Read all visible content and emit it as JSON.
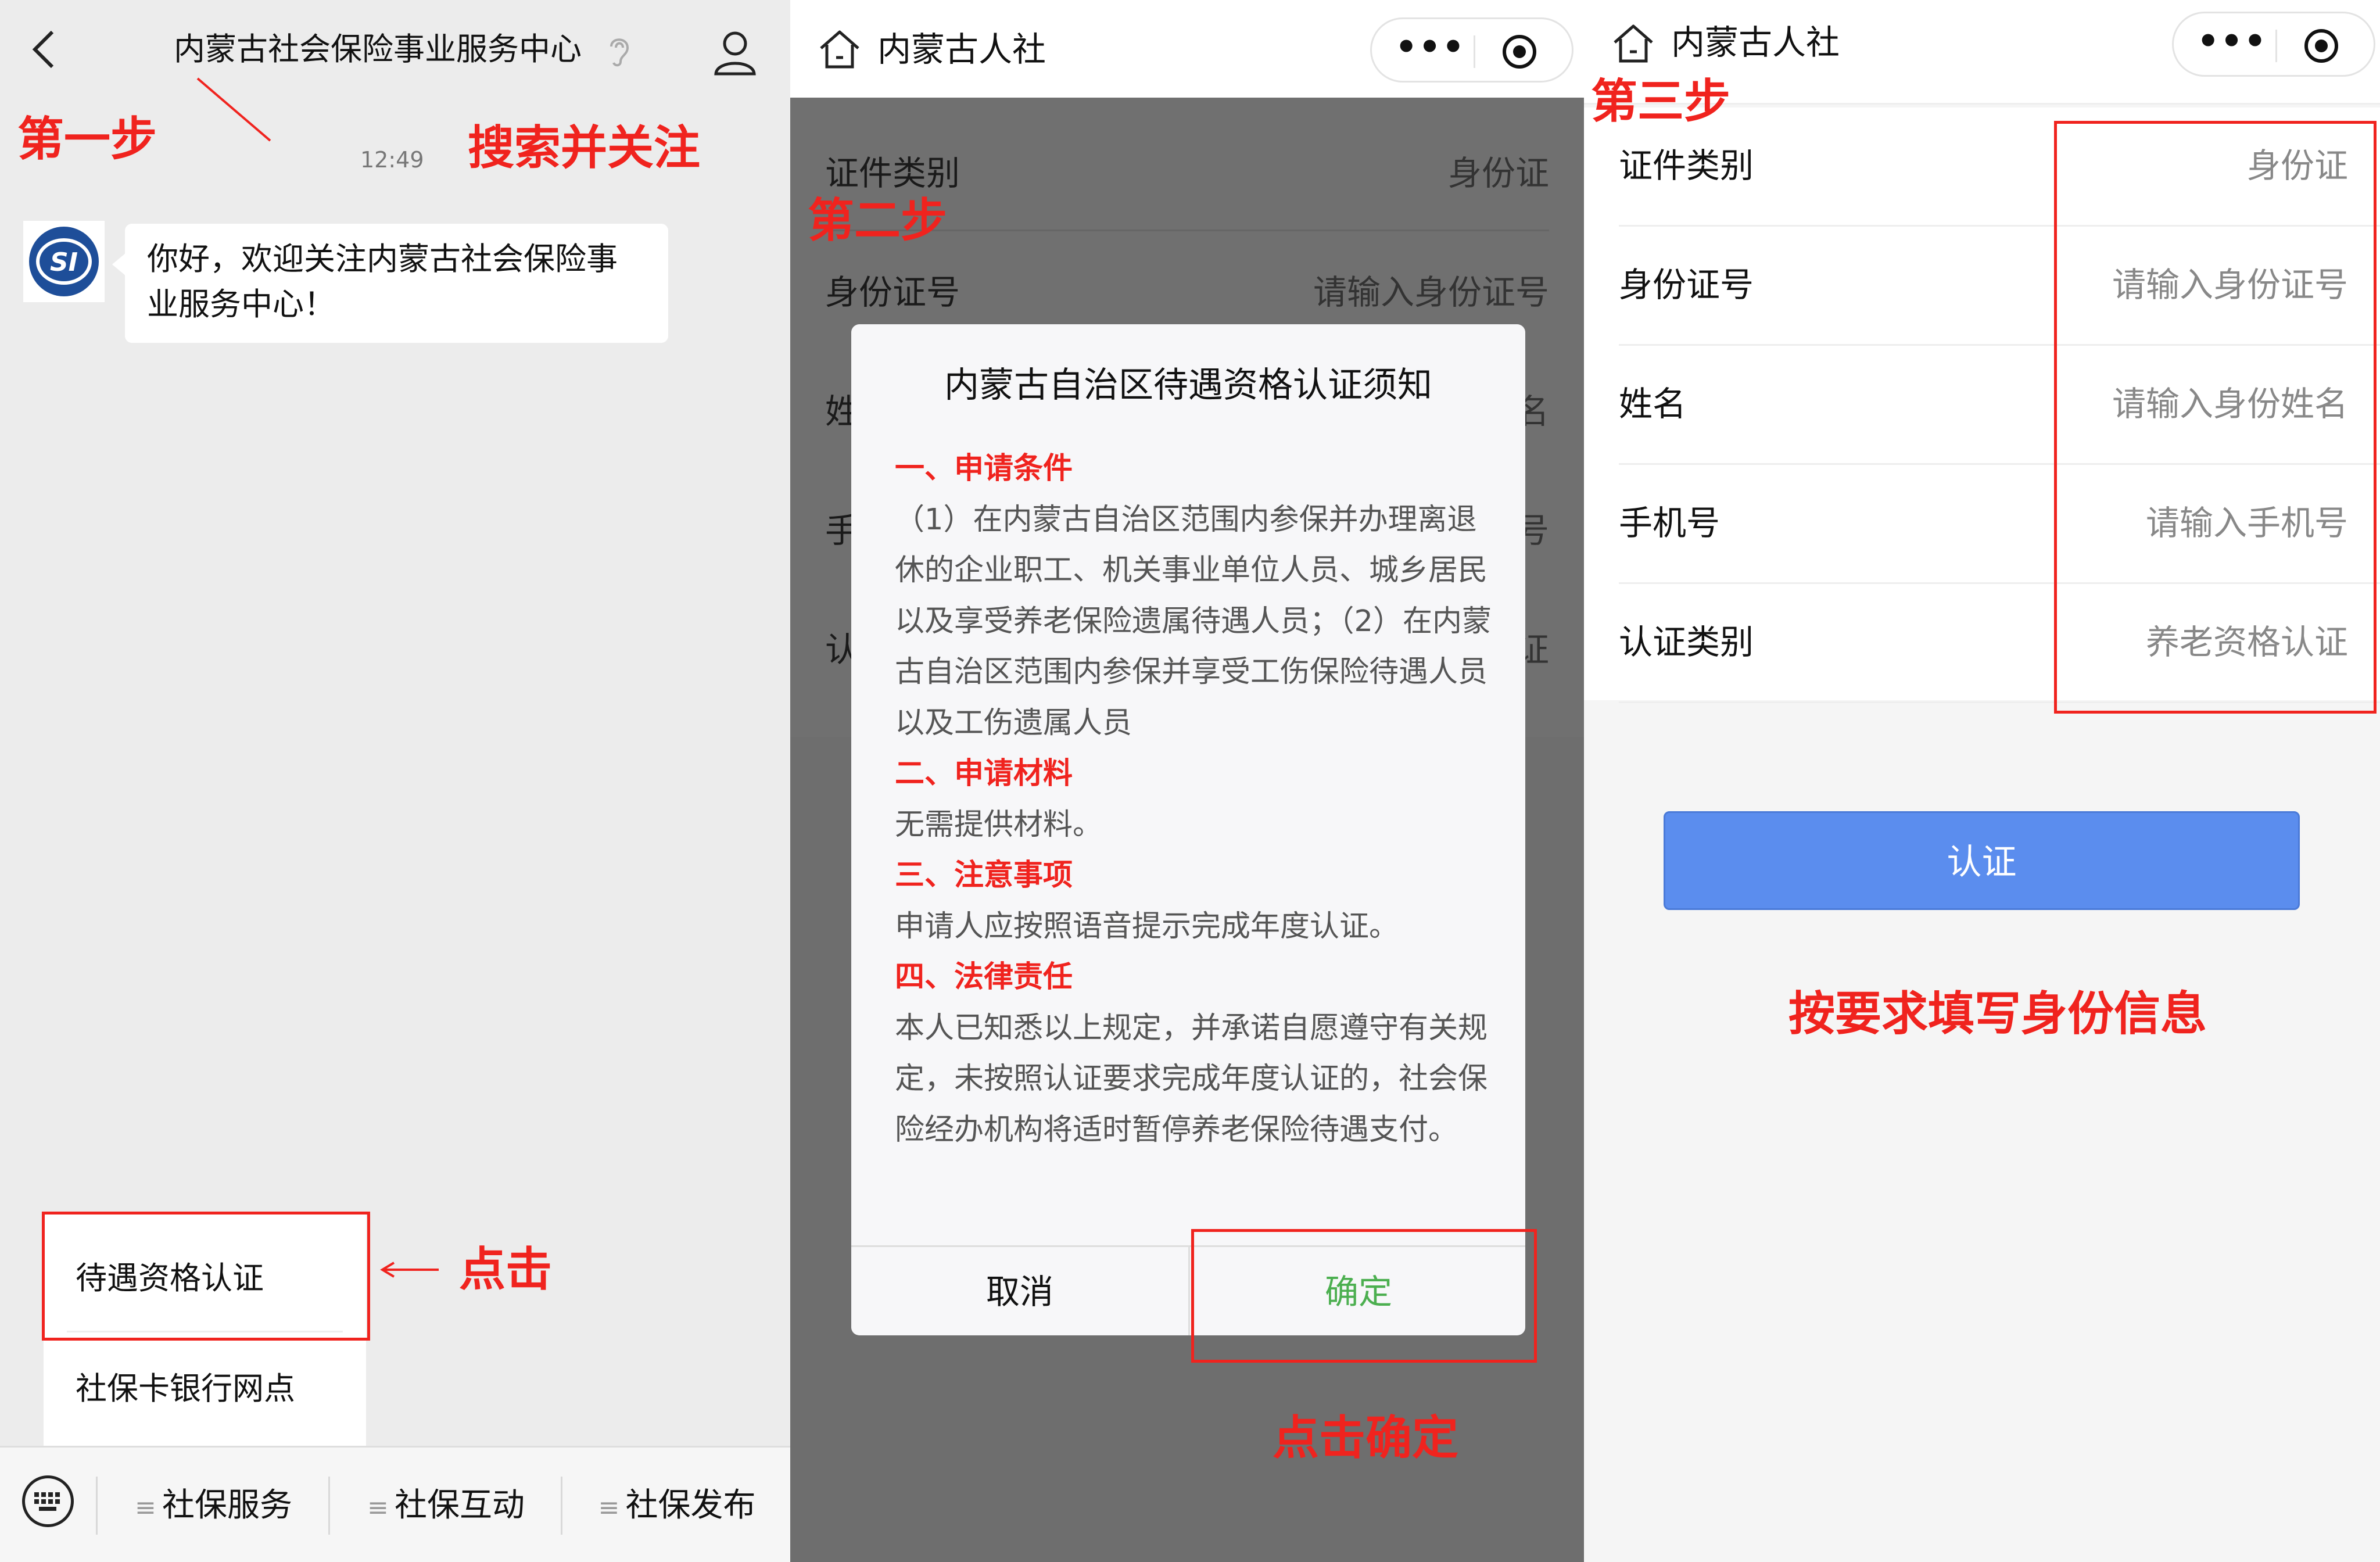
{
  "panel1": {
    "title": "内蒙古社会保险事业服务中心",
    "step_label": "第一步",
    "follow_hint": "搜索并关注",
    "time": "12:49",
    "avatar_text": "SI",
    "welcome_message": "你好，欢迎关注内蒙古社会保险事业服务中心！",
    "menu_items": [
      "待遇资格认证",
      "社保卡银行网点"
    ],
    "click_hint": "点击",
    "tabs": [
      "社保服务",
      "社保互动",
      "社保发布"
    ],
    "tab_icon": "≡"
  },
  "panel2": {
    "header_title": "内蒙古人社",
    "capsule_dots": "•••",
    "step_label": "第二步",
    "bg_rows": [
      {
        "label": "证件类别",
        "value": "身份证"
      },
      {
        "label": "身份证号",
        "value": "请输入身份证号"
      },
      {
        "label": "姓",
        "value": "名"
      },
      {
        "label": "手",
        "value": "号"
      },
      {
        "label": "认",
        "value": "证"
      }
    ],
    "dialog": {
      "title": "内蒙古自治区待遇资格认证须知",
      "sections": [
        {
          "heading": "一、申请条件",
          "body": "（1）在内蒙古自治区范围内参保并办理离退休的企业职工、机关事业单位人员、城乡居民以及享受养老保险遗属待遇人员；（2）在内蒙古自治区范围内参保并享受工伤保险待遇人员以及工伤遗属人员"
        },
        {
          "heading": "二、申请材料",
          "body": "无需提供材料。"
        },
        {
          "heading": "三、注意事项",
          "body": "申请人应按照语音提示完成年度认证。"
        },
        {
          "heading": "四、法律责任",
          "body": "本人已知悉以上规定，并承诺自愿遵守有关规定，未按照认证要求完成年度认证的，社会保险经办机构将适时暂停养老保险待遇支付。"
        }
      ],
      "cancel_label": "取消",
      "confirm_label": "确定"
    },
    "click_confirm_hint": "点击确定"
  },
  "panel3": {
    "header_title": "内蒙古人社",
    "capsule_dots": "•••",
    "step_label": "第三步",
    "rows": [
      {
        "label": "证件类别",
        "placeholder": "身份证"
      },
      {
        "label": "身份证号",
        "placeholder": "请输入身份证号"
      },
      {
        "label": "姓名",
        "placeholder": "请输入身份姓名"
      },
      {
        "label": "手机号",
        "placeholder": "请输入手机号"
      },
      {
        "label": "认证类别",
        "placeholder": "养老资格认证"
      }
    ],
    "auth_button": "认证",
    "fill_hint": "按要求填写身份信息"
  },
  "colors": {
    "annotation_red": "#f0231e",
    "confirm_green": "#4caf50",
    "button_blue": "#5b8dee"
  }
}
